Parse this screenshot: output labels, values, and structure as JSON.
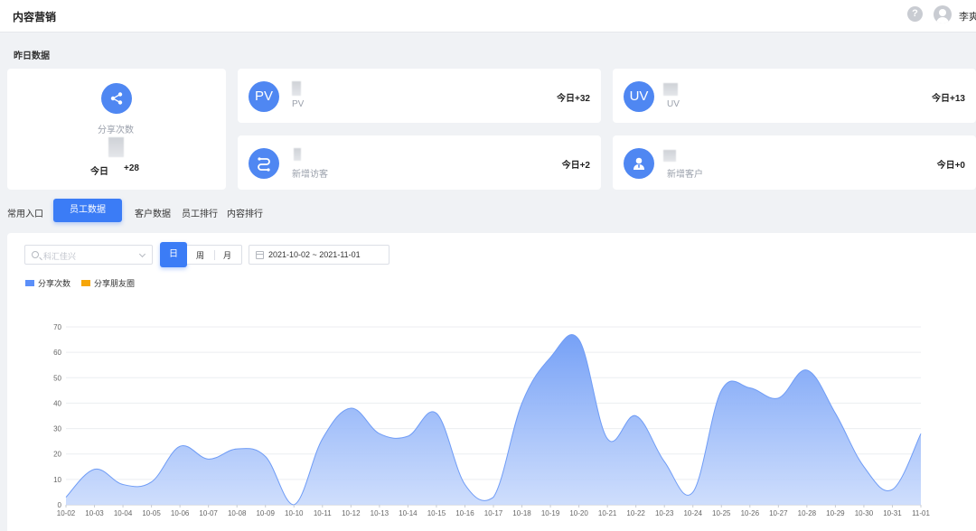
{
  "header": {
    "app_title": "内容营销",
    "help_icon": "question-circle-icon",
    "user_icon": "user-avatar-icon",
    "user_name": "李爽"
  },
  "yesterday": {
    "section_title": "昨日数据",
    "share": {
      "icon": "share-icon",
      "label": "分享次数",
      "today_label": "今日",
      "today_value": "+28"
    },
    "pv": {
      "badge": "PV",
      "label": "PV",
      "today": "今日+32"
    },
    "uv": {
      "badge": "UV",
      "label": "UV",
      "today": "今日+13"
    },
    "new_visitors": {
      "icon": "route-icon",
      "label": "新增访客",
      "today": "今日+2"
    },
    "new_customers": {
      "icon": "user-badge-icon",
      "label": "新增客户",
      "today": "今日+0"
    }
  },
  "tabs": {
    "common": "常用入口",
    "staff": "员工数据",
    "customer": "客户数据",
    "staff_rank": "员工排行",
    "content_rank": "内容排行"
  },
  "filters": {
    "search_placeholder": "科汇佳兴",
    "granularity": {
      "day": "日",
      "week": "周",
      "month": "月",
      "selected": "日"
    },
    "date_range": "2021-10-02 ~ 2021-11-01"
  },
  "colors": {
    "accent": "#3b7cf6",
    "series_share": "#5b8ff9",
    "series_moments": "#f6a609"
  },
  "chart_data": {
    "type": "area",
    "title": "",
    "xlabel": "",
    "ylabel": "",
    "ylim": [
      0,
      70
    ],
    "yticks": [
      0,
      10,
      20,
      30,
      40,
      50,
      60,
      70
    ],
    "grid": true,
    "legend": "top-left",
    "categories": [
      "10-02",
      "10-03",
      "10-04",
      "10-05",
      "10-06",
      "10-07",
      "10-08",
      "10-09",
      "10-10",
      "10-11",
      "10-12",
      "10-13",
      "10-14",
      "10-15",
      "10-16",
      "10-17",
      "10-18",
      "10-19",
      "10-20",
      "10-21",
      "10-22",
      "10-23",
      "10-24",
      "10-25",
      "10-26",
      "10-27",
      "10-28",
      "10-29",
      "10-30",
      "10-31",
      "11-01"
    ],
    "series": [
      {
        "name": "分享次数",
        "values": [
          3,
          14,
          8,
          9,
          23,
          18,
          22,
          19,
          0,
          26,
          38,
          28,
          27,
          36,
          8,
          3,
          40,
          58,
          65,
          26,
          35,
          17,
          5,
          45,
          46,
          42,
          53,
          36,
          15,
          6,
          28
        ]
      },
      {
        "name": "分享朋友圈",
        "values": [
          0,
          0,
          0,
          0,
          0,
          0,
          0,
          0,
          0,
          0,
          0,
          0,
          0,
          0,
          0,
          0,
          0,
          0,
          0,
          0,
          0,
          0,
          0,
          0,
          0,
          0,
          0,
          0,
          0,
          0,
          0
        ]
      }
    ]
  }
}
